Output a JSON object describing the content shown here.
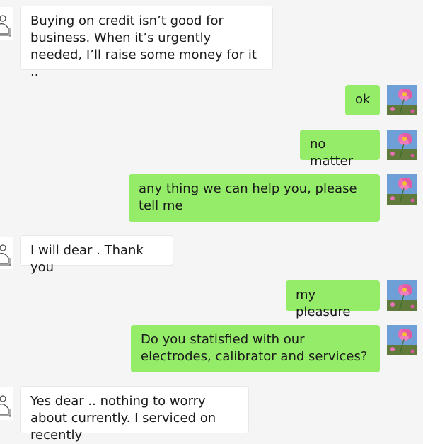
{
  "chat": {
    "messages": [
      {
        "side": "incoming",
        "text": "Buying on credit isn’t good for business. When it’s urgently needed, I’ll raise some money for it .."
      },
      {
        "side": "outgoing",
        "text": "ok"
      },
      {
        "side": "outgoing",
        "text": "no matter"
      },
      {
        "side": "outgoing",
        "text": "any thing we can help you, please tell me"
      },
      {
        "side": "incoming",
        "text": "I will dear . Thank you"
      },
      {
        "side": "outgoing",
        "text": "my pleasure"
      },
      {
        "side": "outgoing",
        "text": "Do you statisfied with our electrodes, calibrator and services?"
      },
      {
        "side": "incoming",
        "text": "Yes dear .. nothing to worry about currently. I serviced on recently"
      }
    ]
  },
  "avatars": {
    "contact_icon": "sketch-avatar-icon",
    "self_icon": "pink-cosmos-flower-avatar-icon"
  },
  "colors": {
    "background": "#f5f5f5",
    "incoming_bubble": "#ffffff",
    "outgoing_bubble": "#95ec69",
    "text": "#1a1a1a"
  }
}
